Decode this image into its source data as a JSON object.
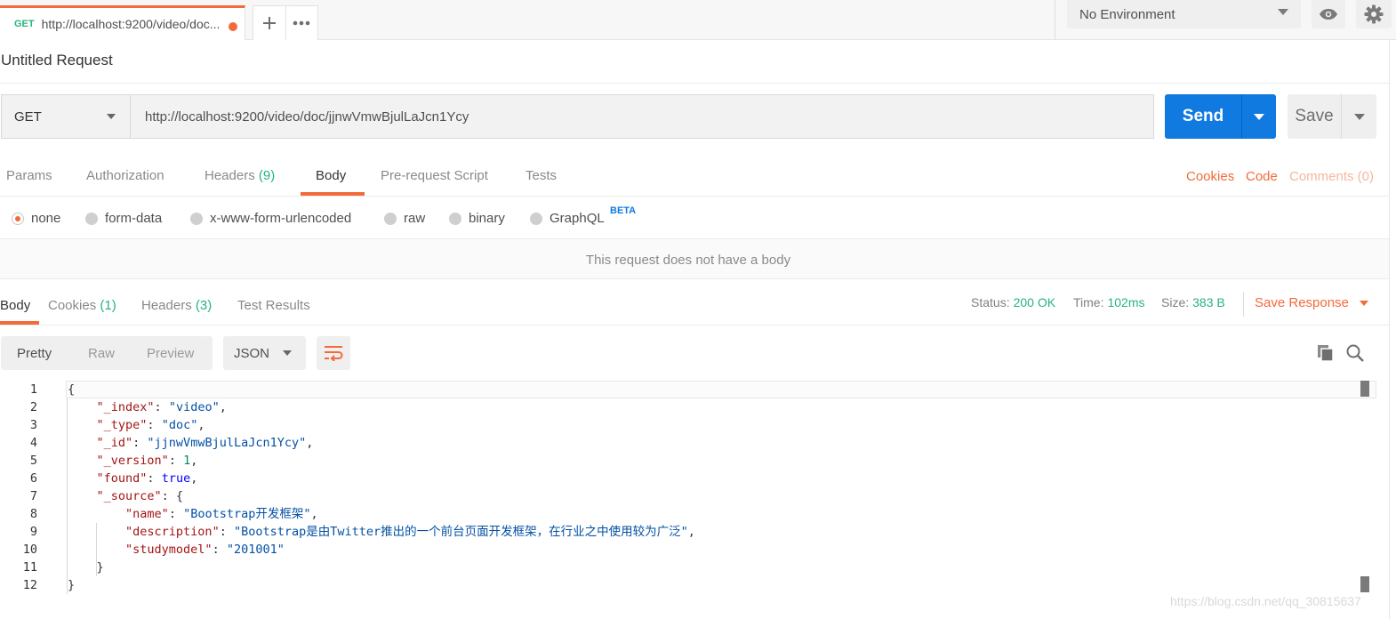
{
  "tab": {
    "method": "GET",
    "url": "http://localhost:9200/video/doc..."
  },
  "environment": {
    "selected": "No Environment"
  },
  "request": {
    "title": "Untitled Request",
    "method": "GET",
    "url": "http://localhost:9200/video/doc/jjnwVmwBjulLaJcn1Ycy",
    "send_label": "Send",
    "save_label": "Save"
  },
  "request_tabs": {
    "params": "Params",
    "authorization": "Authorization",
    "headers": "Headers",
    "headers_count": "(9)",
    "body": "Body",
    "pre_request": "Pre-request Script",
    "tests": "Tests"
  },
  "request_links": {
    "cookies": "Cookies",
    "code": "Code",
    "comments": "Comments (0)"
  },
  "body_types": {
    "none": "none",
    "form_data": "form-data",
    "urlencoded": "x-www-form-urlencoded",
    "raw": "raw",
    "binary": "binary",
    "graphql": "GraphQL",
    "beta": "BETA"
  },
  "no_body_message": "This request does not have a body",
  "response_tabs": {
    "body": "Body",
    "cookies": "Cookies",
    "cookies_count": "(1)",
    "headers": "Headers",
    "headers_count": "(3)",
    "test_results": "Test Results"
  },
  "response_status": {
    "status_label": "Status:",
    "status_value": "200 OK",
    "time_label": "Time:",
    "time_value": "102ms",
    "size_label": "Size:",
    "size_value": "383 B",
    "save_response": "Save Response"
  },
  "view": {
    "pretty": "Pretty",
    "raw": "Raw",
    "preview": "Preview",
    "format": "JSON"
  },
  "response_body": {
    "line_numbers": [
      "1",
      "2",
      "3",
      "4",
      "5",
      "6",
      "7",
      "8",
      "9",
      "10",
      "11",
      "12"
    ],
    "index_key": "\"_index\"",
    "index_val": "\"video\"",
    "type_key": "\"_type\"",
    "type_val": "\"doc\"",
    "id_key": "\"_id\"",
    "id_val": "\"jjnwVmwBjulLaJcn1Ycy\"",
    "version_key": "\"_version\"",
    "version_val": "1",
    "found_key": "\"found\"",
    "found_val": "true",
    "source_key": "\"_source\"",
    "name_key": "\"name\"",
    "name_val": "\"Bootstrap开发框架\"",
    "desc_key": "\"description\"",
    "desc_val": "\"Bootstrap是由Twitter推出的一个前台页面开发框架，在行业之中使用较为广泛\"",
    "studymodel_key": "\"studymodel\"",
    "studymodel_val": "\"201001\""
  },
  "watermark": "https://blog.csdn.net/qq_30815637",
  "colors": {
    "accent_orange": "#f26b3a",
    "send_blue": "#107ae0",
    "count_green": "#26b47f"
  },
  "icons": [
    "plus-icon",
    "more-dots-icon",
    "eye-icon",
    "gear-icon",
    "wrap-lines-icon",
    "copy-icon",
    "search-icon"
  ]
}
